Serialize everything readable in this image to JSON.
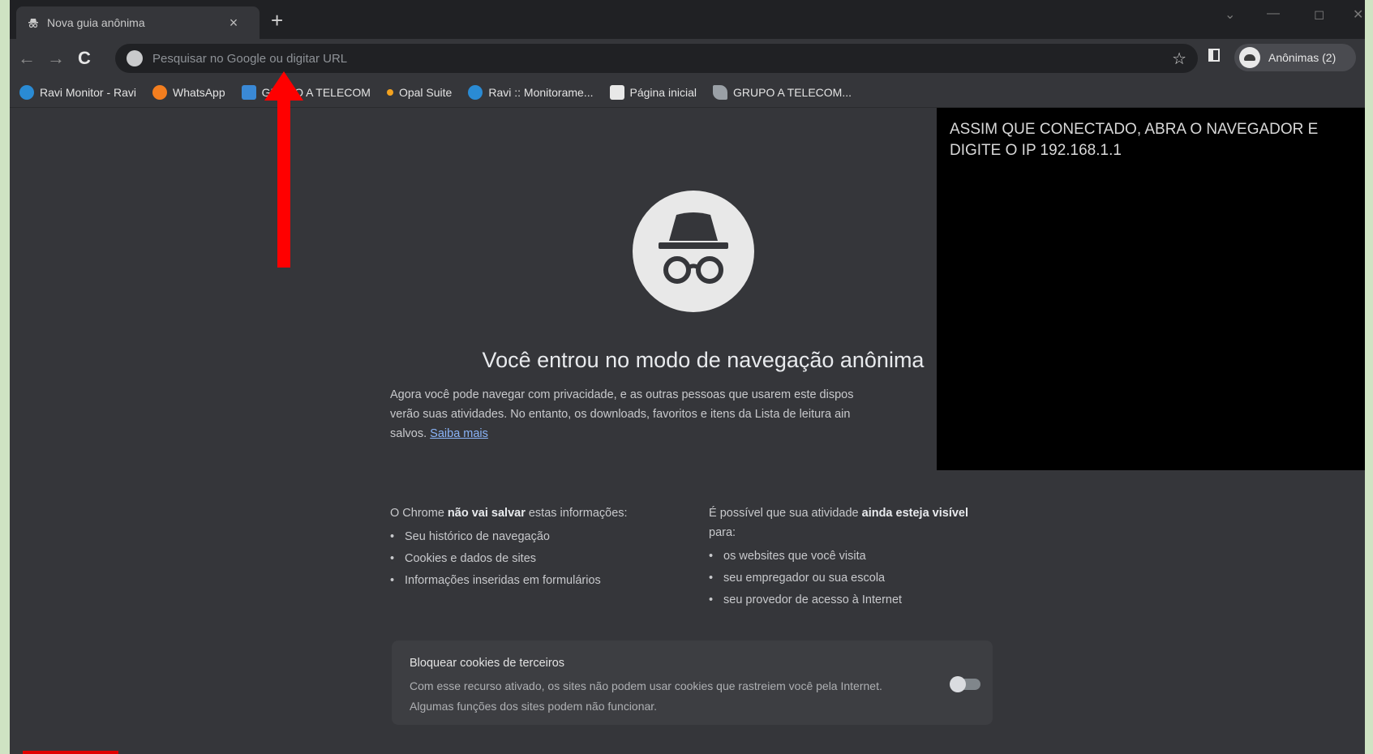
{
  "tab": {
    "title": "Nova guia anônima",
    "close": "×",
    "new_tab": "+"
  },
  "window_controls": {
    "dropdown": "⌄",
    "minimize": "—",
    "maximize": "◻",
    "close": "✕"
  },
  "toolbar": {
    "back": "←",
    "forward": "→",
    "reload": "C",
    "star": "☆",
    "omnibox_placeholder": "Pesquisar no Google ou digitar URL",
    "profile_label": "Anônimas (2)"
  },
  "bookmarks": [
    {
      "label": "Ravi Monitor - Ravi",
      "icon": "ravi-icon",
      "color": "#2a8bd4"
    },
    {
      "label": "WhatsApp",
      "icon": "whatsapp-icon",
      "color": "#f37e1f"
    },
    {
      "label": "GRUPO A TELECOM",
      "icon": "grupo-a-icon",
      "color": "#3a89d6"
    },
    {
      "label": "Opal Suite",
      "icon": "opal-icon",
      "color": "#f3a21f"
    },
    {
      "label": "Ravi :: Monitorame...",
      "icon": "ravi-icon",
      "color": "#2a8bd4"
    },
    {
      "label": "Página inicial",
      "icon": "w-icon",
      "color": "#e8e8e8"
    },
    {
      "label": "GRUPO A TELECOM...",
      "icon": "leaf-icon",
      "color": "#9aa0a6"
    }
  ],
  "incognito": {
    "headline": "Você entrou no modo de navegação anônima",
    "paragraph_line1": "Agora você pode navegar com privacidade, e as outras pessoas que usarem este dispos",
    "paragraph_line2": "verão suas atividades. No entanto, os downloads, favoritos e itens da Lista de leitura ain",
    "paragraph_line3": "salvos.",
    "learn_more": "Saiba mais",
    "left_col": {
      "title_prefix": "O Chrome ",
      "title_bold": "não vai salvar",
      "title_suffix": " estas informações:",
      "items": [
        "Seu histórico de navegação",
        "Cookies e dados de sites",
        "Informações inseridas em formulários"
      ]
    },
    "right_col": {
      "title_prefix": "É possível que sua atividade ",
      "title_bold": "ainda esteja visível",
      "title_suffix": " para:",
      "items": [
        "os websites que você visita",
        "seu empregador ou sua escola",
        "seu provedor de acesso à Internet"
      ]
    },
    "cookie": {
      "title": "Bloquear cookies de terceiros",
      "desc": "Com esse recurso ativado, os sites não podem usar cookies que rastreiem você pela Internet. Algumas funções dos sites podem não funcionar.",
      "toggle_on": false
    }
  },
  "overlay": {
    "text": "ASSIM QUE CONECTADO, ABRA O NAVEGADOR E DIGITE O IP 192.168.1.1"
  },
  "colors": {
    "annotation_arrow": "#ff0000",
    "window_bg": "#35363a",
    "frame_bg": "#cfe3c3"
  }
}
